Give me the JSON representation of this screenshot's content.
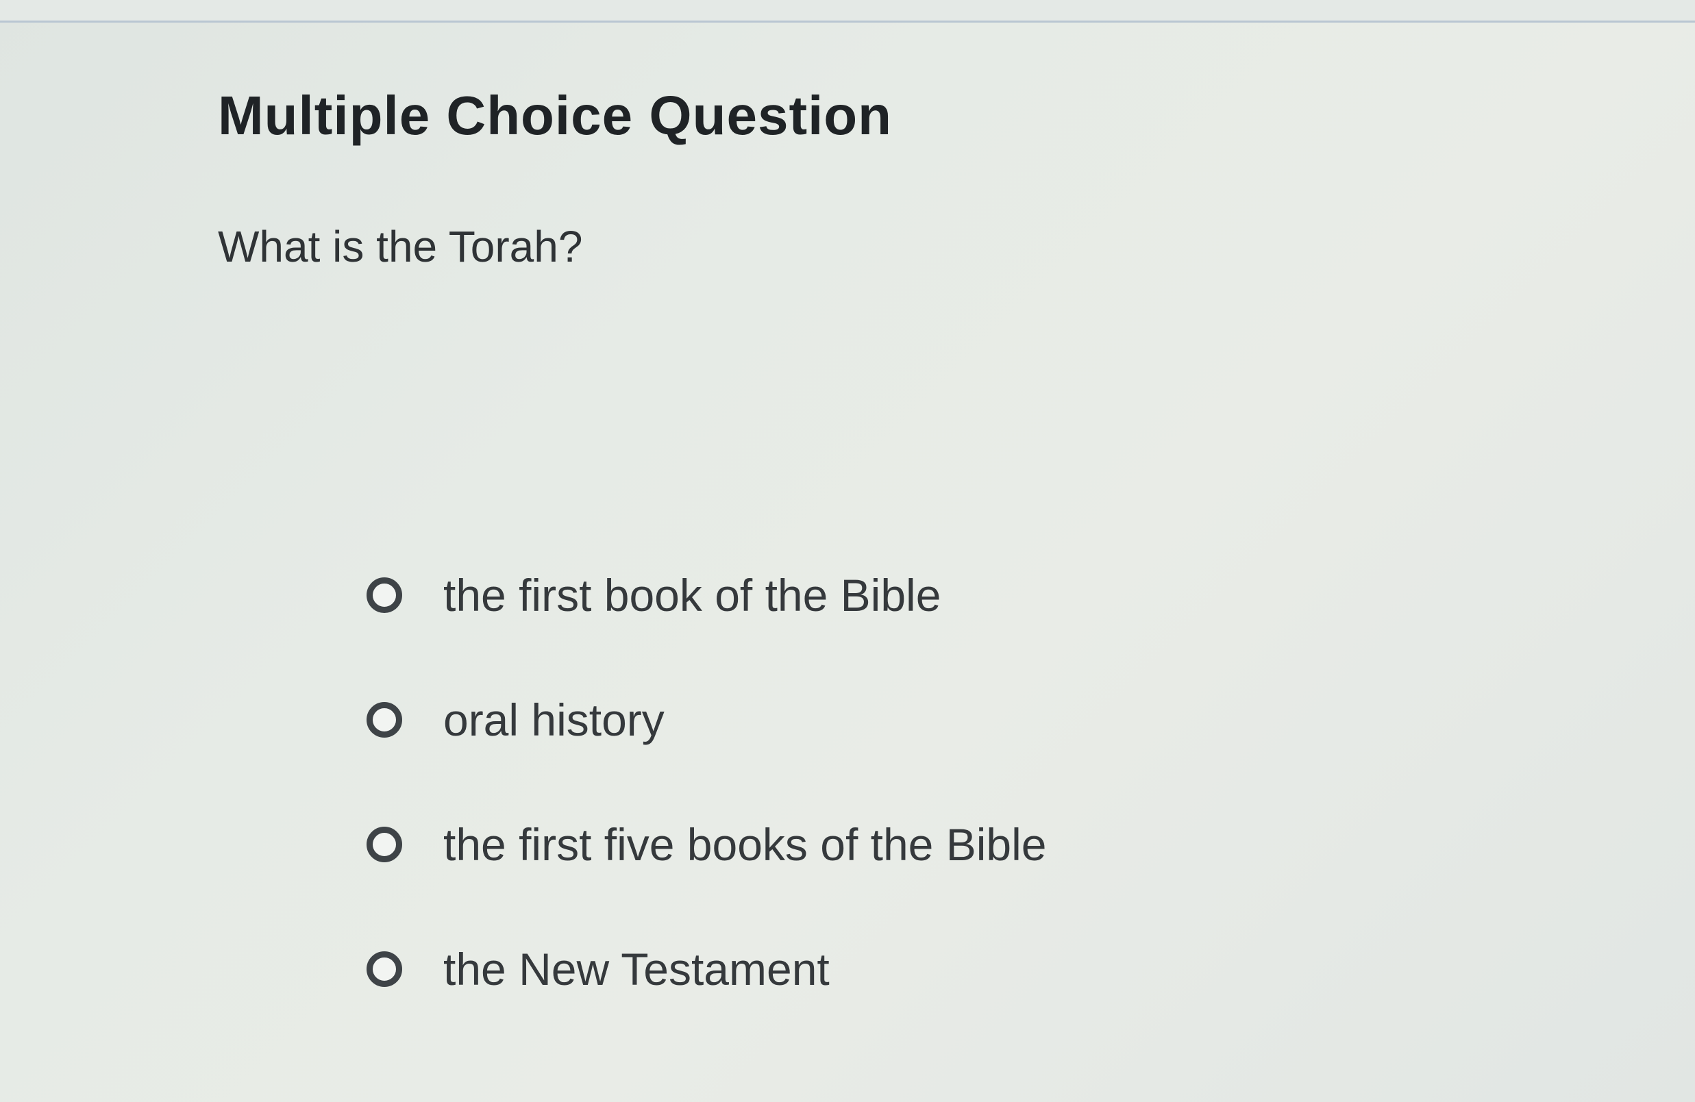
{
  "question": {
    "heading": "Multiple Choice Question",
    "prompt": "What is the Torah?",
    "options": [
      {
        "label": "the first book of the Bible",
        "selected": false
      },
      {
        "label": "oral history",
        "selected": false
      },
      {
        "label": "the first five books of the Bible",
        "selected": false
      },
      {
        "label": "the New Testament",
        "selected": false
      }
    ]
  },
  "colors": {
    "background": "#e6ebe6",
    "heading_text": "#1f2326",
    "body_text": "#35393c",
    "radio_border": "#3e4347",
    "top_border": "#b9c6d2"
  }
}
